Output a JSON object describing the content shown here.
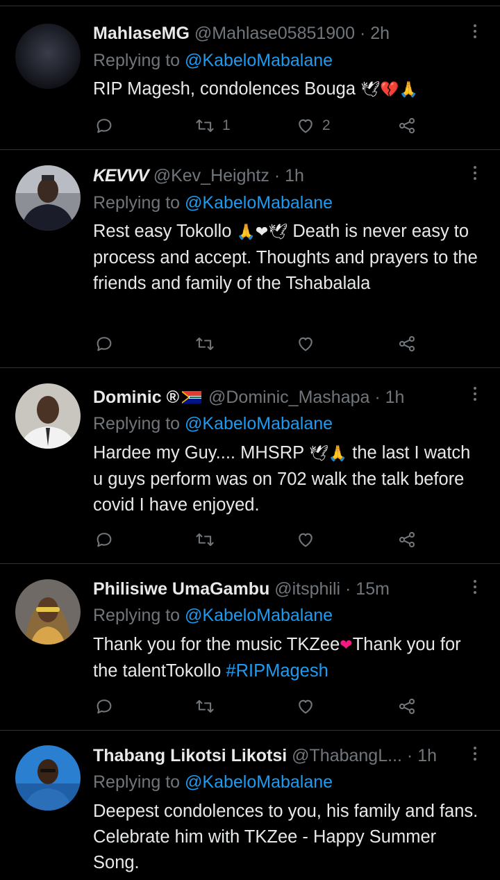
{
  "thread": {
    "reply_prefix": "Replying to",
    "reply_to": "@KabeloMabalane"
  },
  "tweets": [
    {
      "name": "MahlaseMG",
      "handle": "@Mahlase05851900",
      "dot": "·",
      "time": "2h",
      "text": "RIP Magesh, condolences Bouga",
      "emoji": "🕊💔🙏",
      "retweets": "1",
      "likes": "2"
    },
    {
      "name": "KEVVV",
      "handle": "@Kev_Heightz",
      "dot": "·",
      "time": "1h",
      "text_pre": "Rest easy Tokollo",
      "emoji": "🙏❤🕊",
      "text": "Death is never easy to process and accept. Thoughts and prayers to the friends and family of the Tshabalala",
      "retweets": "",
      "likes": ""
    },
    {
      "name": "Dominic ®",
      "handle": "@Dominic_Mashapa",
      "dot": "·",
      "time": "1h",
      "text_pre": "Hardee my Guy.... MHSRP",
      "emoji": "🕊🙏",
      "text": "the last I watch u guys perform was on 702 walk the talk before covid I have enjoyed.",
      "retweets": "",
      "likes": ""
    },
    {
      "name": "Philisiwe UmaGambu",
      "handle": "@itsphili",
      "dot": "·",
      "time": "15m",
      "text_pre": "Thank you for the music TKZee",
      "emoji": "❤",
      "text": "Thank you for the talentTokollo",
      "hashtag": "#RIPMagesh",
      "retweets": "",
      "likes": ""
    },
    {
      "name": "Thabang Likotsi Likotsi",
      "handle": "@ThabangL...",
      "dot": "·",
      "time": "1h",
      "text": "Deepest condolences to you, his family and fans.  Celebrate him with TKZee - Happy Summer Song."
    }
  ],
  "colors": {
    "background": "#000000",
    "text": "#e7e9ea",
    "muted": "#71767b",
    "link": "#1d9bf0",
    "divider": "#2f3336",
    "heart": "#f91880"
  }
}
